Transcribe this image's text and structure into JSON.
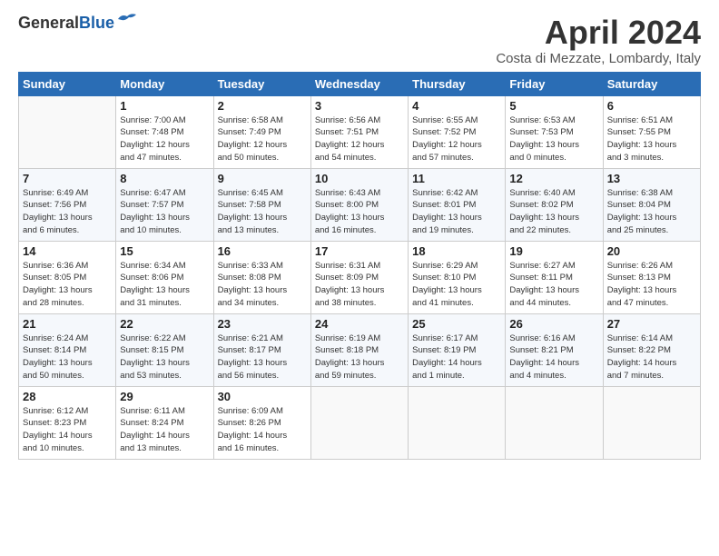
{
  "header": {
    "logo_general": "General",
    "logo_blue": "Blue",
    "month_title": "April 2024",
    "location": "Costa di Mezzate, Lombardy, Italy"
  },
  "weekdays": [
    "Sunday",
    "Monday",
    "Tuesday",
    "Wednesday",
    "Thursday",
    "Friday",
    "Saturday"
  ],
  "weeks": [
    [
      {
        "day": "",
        "info": ""
      },
      {
        "day": "1",
        "info": "Sunrise: 7:00 AM\nSunset: 7:48 PM\nDaylight: 12 hours\nand 47 minutes."
      },
      {
        "day": "2",
        "info": "Sunrise: 6:58 AM\nSunset: 7:49 PM\nDaylight: 12 hours\nand 50 minutes."
      },
      {
        "day": "3",
        "info": "Sunrise: 6:56 AM\nSunset: 7:51 PM\nDaylight: 12 hours\nand 54 minutes."
      },
      {
        "day": "4",
        "info": "Sunrise: 6:55 AM\nSunset: 7:52 PM\nDaylight: 12 hours\nand 57 minutes."
      },
      {
        "day": "5",
        "info": "Sunrise: 6:53 AM\nSunset: 7:53 PM\nDaylight: 13 hours\nand 0 minutes."
      },
      {
        "day": "6",
        "info": "Sunrise: 6:51 AM\nSunset: 7:55 PM\nDaylight: 13 hours\nand 3 minutes."
      }
    ],
    [
      {
        "day": "7",
        "info": "Sunrise: 6:49 AM\nSunset: 7:56 PM\nDaylight: 13 hours\nand 6 minutes."
      },
      {
        "day": "8",
        "info": "Sunrise: 6:47 AM\nSunset: 7:57 PM\nDaylight: 13 hours\nand 10 minutes."
      },
      {
        "day": "9",
        "info": "Sunrise: 6:45 AM\nSunset: 7:58 PM\nDaylight: 13 hours\nand 13 minutes."
      },
      {
        "day": "10",
        "info": "Sunrise: 6:43 AM\nSunset: 8:00 PM\nDaylight: 13 hours\nand 16 minutes."
      },
      {
        "day": "11",
        "info": "Sunrise: 6:42 AM\nSunset: 8:01 PM\nDaylight: 13 hours\nand 19 minutes."
      },
      {
        "day": "12",
        "info": "Sunrise: 6:40 AM\nSunset: 8:02 PM\nDaylight: 13 hours\nand 22 minutes."
      },
      {
        "day": "13",
        "info": "Sunrise: 6:38 AM\nSunset: 8:04 PM\nDaylight: 13 hours\nand 25 minutes."
      }
    ],
    [
      {
        "day": "14",
        "info": "Sunrise: 6:36 AM\nSunset: 8:05 PM\nDaylight: 13 hours\nand 28 minutes."
      },
      {
        "day": "15",
        "info": "Sunrise: 6:34 AM\nSunset: 8:06 PM\nDaylight: 13 hours\nand 31 minutes."
      },
      {
        "day": "16",
        "info": "Sunrise: 6:33 AM\nSunset: 8:08 PM\nDaylight: 13 hours\nand 34 minutes."
      },
      {
        "day": "17",
        "info": "Sunrise: 6:31 AM\nSunset: 8:09 PM\nDaylight: 13 hours\nand 38 minutes."
      },
      {
        "day": "18",
        "info": "Sunrise: 6:29 AM\nSunset: 8:10 PM\nDaylight: 13 hours\nand 41 minutes."
      },
      {
        "day": "19",
        "info": "Sunrise: 6:27 AM\nSunset: 8:11 PM\nDaylight: 13 hours\nand 44 minutes."
      },
      {
        "day": "20",
        "info": "Sunrise: 6:26 AM\nSunset: 8:13 PM\nDaylight: 13 hours\nand 47 minutes."
      }
    ],
    [
      {
        "day": "21",
        "info": "Sunrise: 6:24 AM\nSunset: 8:14 PM\nDaylight: 13 hours\nand 50 minutes."
      },
      {
        "day": "22",
        "info": "Sunrise: 6:22 AM\nSunset: 8:15 PM\nDaylight: 13 hours\nand 53 minutes."
      },
      {
        "day": "23",
        "info": "Sunrise: 6:21 AM\nSunset: 8:17 PM\nDaylight: 13 hours\nand 56 minutes."
      },
      {
        "day": "24",
        "info": "Sunrise: 6:19 AM\nSunset: 8:18 PM\nDaylight: 13 hours\nand 59 minutes."
      },
      {
        "day": "25",
        "info": "Sunrise: 6:17 AM\nSunset: 8:19 PM\nDaylight: 14 hours\nand 1 minute."
      },
      {
        "day": "26",
        "info": "Sunrise: 6:16 AM\nSunset: 8:21 PM\nDaylight: 14 hours\nand 4 minutes."
      },
      {
        "day": "27",
        "info": "Sunrise: 6:14 AM\nSunset: 8:22 PM\nDaylight: 14 hours\nand 7 minutes."
      }
    ],
    [
      {
        "day": "28",
        "info": "Sunrise: 6:12 AM\nSunset: 8:23 PM\nDaylight: 14 hours\nand 10 minutes."
      },
      {
        "day": "29",
        "info": "Sunrise: 6:11 AM\nSunset: 8:24 PM\nDaylight: 14 hours\nand 13 minutes."
      },
      {
        "day": "30",
        "info": "Sunrise: 6:09 AM\nSunset: 8:26 PM\nDaylight: 14 hours\nand 16 minutes."
      },
      {
        "day": "",
        "info": ""
      },
      {
        "day": "",
        "info": ""
      },
      {
        "day": "",
        "info": ""
      },
      {
        "day": "",
        "info": ""
      }
    ]
  ],
  "row_colors": [
    "white",
    "shade",
    "white",
    "shade",
    "white"
  ]
}
